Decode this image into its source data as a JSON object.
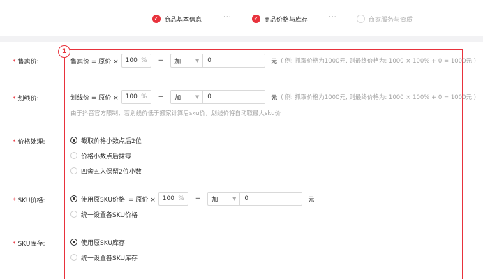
{
  "steps": [
    {
      "label": "商品基本信息",
      "state": "done"
    },
    {
      "label": "商品价格与库存",
      "state": "done"
    },
    {
      "label": "商家服务与资质",
      "state": "todo"
    }
  ],
  "step_separator": "···",
  "badge": "1",
  "colors": {
    "accent": "#e8323c",
    "hint": "#a3a3a3"
  },
  "sale_price": {
    "label": "售卖价:",
    "prefix": "售卖价 = 原价 ×",
    "percent": "100",
    "percent_unit": "%",
    "plus": "+",
    "op": "加",
    "amount": "0",
    "unit": "元",
    "hint": "( 例: 抓取价格为1000元, 则最终价格为: 1000 × 100% + 0 = 1000元 )"
  },
  "strike_price": {
    "label": "划线价:",
    "prefix": "划线价 = 原价 ×",
    "percent": "100",
    "percent_unit": "%",
    "plus": "+",
    "op": "加",
    "amount": "0",
    "unit": "元",
    "hint": "( 例: 抓取价格为1000元, 则最终价格为: 1000 × 100% + 0 = 1000元 )",
    "note": "由于抖音官方限制，若划线价低于搬家计算后sku价，划线价将自动取最大sku价"
  },
  "price_processing": {
    "label": "价格处理:",
    "options": [
      "截取价格小数点后2位",
      "价格小数点后抹零",
      "四舍五入保留2位小数"
    ],
    "selected": 0
  },
  "sku_price": {
    "label": "SKU价格:",
    "option1": "使用原SKU价格",
    "prefix": "= 原价 ×",
    "percent": "100",
    "percent_unit": "%",
    "plus": "+",
    "op": "加",
    "amount": "0",
    "unit": "元",
    "option2": "统一设置各SKU价格"
  },
  "sku_stock": {
    "label": "SKU库存:",
    "option1": "使用原SKU库存",
    "option2": "统一设置各SKU库存"
  }
}
